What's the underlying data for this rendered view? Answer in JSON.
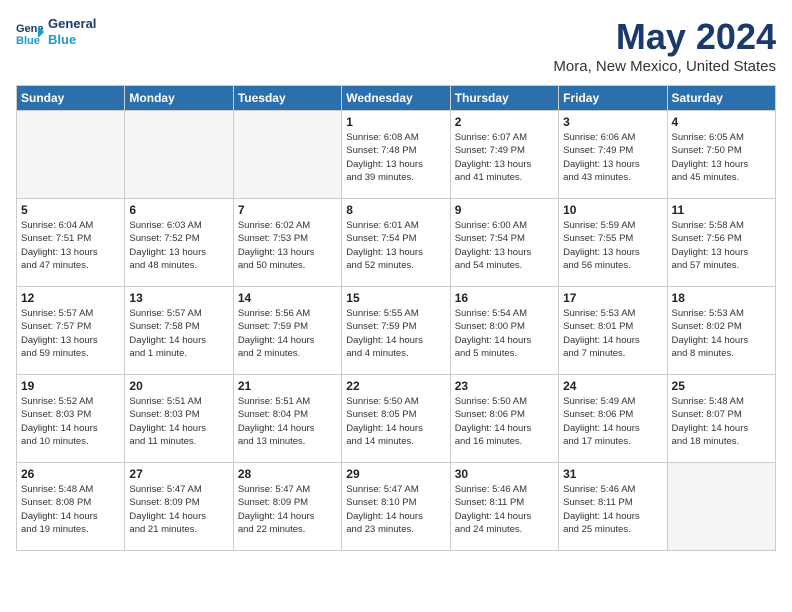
{
  "header": {
    "logo_line1": "General",
    "logo_line2": "Blue",
    "title": "May 2024",
    "subtitle": "Mora, New Mexico, United States"
  },
  "days_of_week": [
    "Sunday",
    "Monday",
    "Tuesday",
    "Wednesday",
    "Thursday",
    "Friday",
    "Saturday"
  ],
  "weeks": [
    [
      {
        "day": "",
        "info": ""
      },
      {
        "day": "",
        "info": ""
      },
      {
        "day": "",
        "info": ""
      },
      {
        "day": "1",
        "info": "Sunrise: 6:08 AM\nSunset: 7:48 PM\nDaylight: 13 hours\nand 39 minutes."
      },
      {
        "day": "2",
        "info": "Sunrise: 6:07 AM\nSunset: 7:49 PM\nDaylight: 13 hours\nand 41 minutes."
      },
      {
        "day": "3",
        "info": "Sunrise: 6:06 AM\nSunset: 7:49 PM\nDaylight: 13 hours\nand 43 minutes."
      },
      {
        "day": "4",
        "info": "Sunrise: 6:05 AM\nSunset: 7:50 PM\nDaylight: 13 hours\nand 45 minutes."
      }
    ],
    [
      {
        "day": "5",
        "info": "Sunrise: 6:04 AM\nSunset: 7:51 PM\nDaylight: 13 hours\nand 47 minutes."
      },
      {
        "day": "6",
        "info": "Sunrise: 6:03 AM\nSunset: 7:52 PM\nDaylight: 13 hours\nand 48 minutes."
      },
      {
        "day": "7",
        "info": "Sunrise: 6:02 AM\nSunset: 7:53 PM\nDaylight: 13 hours\nand 50 minutes."
      },
      {
        "day": "8",
        "info": "Sunrise: 6:01 AM\nSunset: 7:54 PM\nDaylight: 13 hours\nand 52 minutes."
      },
      {
        "day": "9",
        "info": "Sunrise: 6:00 AM\nSunset: 7:54 PM\nDaylight: 13 hours\nand 54 minutes."
      },
      {
        "day": "10",
        "info": "Sunrise: 5:59 AM\nSunset: 7:55 PM\nDaylight: 13 hours\nand 56 minutes."
      },
      {
        "day": "11",
        "info": "Sunrise: 5:58 AM\nSunset: 7:56 PM\nDaylight: 13 hours\nand 57 minutes."
      }
    ],
    [
      {
        "day": "12",
        "info": "Sunrise: 5:57 AM\nSunset: 7:57 PM\nDaylight: 13 hours\nand 59 minutes."
      },
      {
        "day": "13",
        "info": "Sunrise: 5:57 AM\nSunset: 7:58 PM\nDaylight: 14 hours\nand 1 minute."
      },
      {
        "day": "14",
        "info": "Sunrise: 5:56 AM\nSunset: 7:59 PM\nDaylight: 14 hours\nand 2 minutes."
      },
      {
        "day": "15",
        "info": "Sunrise: 5:55 AM\nSunset: 7:59 PM\nDaylight: 14 hours\nand 4 minutes."
      },
      {
        "day": "16",
        "info": "Sunrise: 5:54 AM\nSunset: 8:00 PM\nDaylight: 14 hours\nand 5 minutes."
      },
      {
        "day": "17",
        "info": "Sunrise: 5:53 AM\nSunset: 8:01 PM\nDaylight: 14 hours\nand 7 minutes."
      },
      {
        "day": "18",
        "info": "Sunrise: 5:53 AM\nSunset: 8:02 PM\nDaylight: 14 hours\nand 8 minutes."
      }
    ],
    [
      {
        "day": "19",
        "info": "Sunrise: 5:52 AM\nSunset: 8:03 PM\nDaylight: 14 hours\nand 10 minutes."
      },
      {
        "day": "20",
        "info": "Sunrise: 5:51 AM\nSunset: 8:03 PM\nDaylight: 14 hours\nand 11 minutes."
      },
      {
        "day": "21",
        "info": "Sunrise: 5:51 AM\nSunset: 8:04 PM\nDaylight: 14 hours\nand 13 minutes."
      },
      {
        "day": "22",
        "info": "Sunrise: 5:50 AM\nSunset: 8:05 PM\nDaylight: 14 hours\nand 14 minutes."
      },
      {
        "day": "23",
        "info": "Sunrise: 5:50 AM\nSunset: 8:06 PM\nDaylight: 14 hours\nand 16 minutes."
      },
      {
        "day": "24",
        "info": "Sunrise: 5:49 AM\nSunset: 8:06 PM\nDaylight: 14 hours\nand 17 minutes."
      },
      {
        "day": "25",
        "info": "Sunrise: 5:48 AM\nSunset: 8:07 PM\nDaylight: 14 hours\nand 18 minutes."
      }
    ],
    [
      {
        "day": "26",
        "info": "Sunrise: 5:48 AM\nSunset: 8:08 PM\nDaylight: 14 hours\nand 19 minutes."
      },
      {
        "day": "27",
        "info": "Sunrise: 5:47 AM\nSunset: 8:09 PM\nDaylight: 14 hours\nand 21 minutes."
      },
      {
        "day": "28",
        "info": "Sunrise: 5:47 AM\nSunset: 8:09 PM\nDaylight: 14 hours\nand 22 minutes."
      },
      {
        "day": "29",
        "info": "Sunrise: 5:47 AM\nSunset: 8:10 PM\nDaylight: 14 hours\nand 23 minutes."
      },
      {
        "day": "30",
        "info": "Sunrise: 5:46 AM\nSunset: 8:11 PM\nDaylight: 14 hours\nand 24 minutes."
      },
      {
        "day": "31",
        "info": "Sunrise: 5:46 AM\nSunset: 8:11 PM\nDaylight: 14 hours\nand 25 minutes."
      },
      {
        "day": "",
        "info": ""
      }
    ]
  ],
  "colors": {
    "header_bg": "#2c6fad",
    "logo_dark": "#1a3a6b",
    "logo_light": "#2196c9"
  }
}
